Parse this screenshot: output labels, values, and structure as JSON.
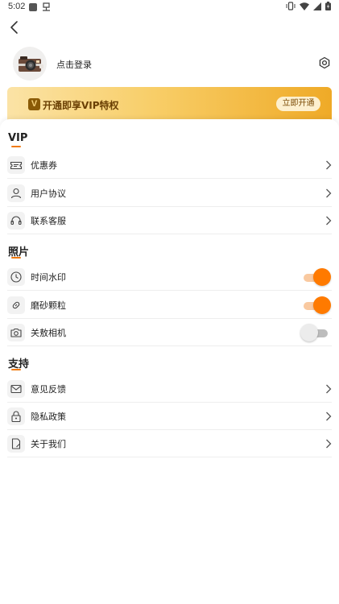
{
  "status_bar": {
    "time": "5:02"
  },
  "profile": {
    "login_text": "点击登录"
  },
  "vip_banner": {
    "logo_glyph": "V",
    "text": "开通即享VIP特权",
    "button_label": "立即开通"
  },
  "sections": {
    "vip": {
      "title": "VIP",
      "items": [
        {
          "label": "优惠券",
          "icon": "ticket-icon"
        },
        {
          "label": "用户协议",
          "icon": "user-icon"
        },
        {
          "label": "联系客服",
          "icon": "headset-icon"
        }
      ]
    },
    "photo": {
      "title": "照片",
      "items": [
        {
          "label": "时间水印",
          "icon": "clock-icon",
          "enabled": true
        },
        {
          "label": "磨砂颗粒",
          "icon": "link-icon",
          "enabled": true
        },
        {
          "label": "关敖相机",
          "icon": "camera-icon",
          "enabled": false
        }
      ]
    },
    "support": {
      "title": "支持",
      "items": [
        {
          "label": "意见反馈",
          "icon": "mail-icon"
        },
        {
          "label": "隐私政策",
          "icon": "lock-icon"
        },
        {
          "label": "关于我们",
          "icon": "document-icon"
        }
      ]
    }
  },
  "colors": {
    "accent": "#ff7a00",
    "vip_gold": "#f8ce68",
    "vip_text": "#6b4004"
  }
}
